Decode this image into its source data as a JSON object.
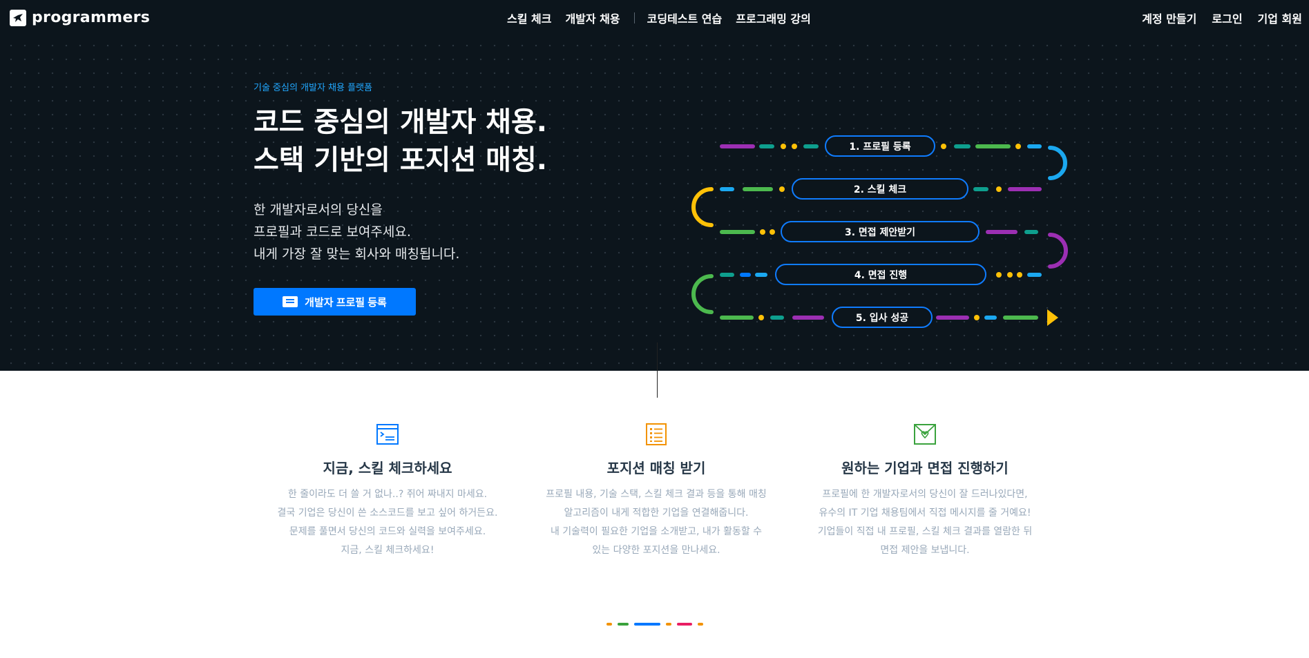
{
  "header": {
    "logo_text": "programmers",
    "nav": [
      "스킬 체크",
      "개발자 채용",
      "코딩테스트 연습",
      "프로그래밍 강의"
    ],
    "auth": [
      "계정 만들기",
      "로그인",
      "기업 회원"
    ]
  },
  "hero": {
    "eyebrow": "기술 중심의 개발자 채용 플랫폼",
    "title_line1": "코드 중심의 개발자 채용.",
    "title_line2": "스택 기반의 포지션 매칭.",
    "sub_line1": "한 개발자로서의 당신을",
    "sub_line2": "프로필과 코드로 보여주세요.",
    "sub_line3": "내게 가장 잘 맞는 회사와 매칭됩니다.",
    "cta_label": "개발자 프로필 등록"
  },
  "flow": {
    "steps": [
      "1. 프로필 등록",
      "2. 스킬 체크",
      "3. 면접 제안받기",
      "4. 면접 진행",
      "5. 입사 성공"
    ],
    "colors": {
      "blue": "#0078ff",
      "cyan": "#1ba8f0",
      "green": "#4cb94e",
      "teal": "#0e9f8e",
      "purple": "#9c2fb3",
      "yellow": "#ffc107"
    }
  },
  "features": [
    {
      "icon": "code-window-icon",
      "title": "지금, 스킬 체크하세요",
      "desc": [
        "한 줄이라도 더 쓸 거 없나..? 쥐어 짜내지 마세요.",
        "결국 기업은 당신이 쓴 소스코드를 보고 싶어 하거든요.",
        "문제를 풀면서 당신의 코드와 실력을 보여주세요.",
        "지금, 스킬 체크하세요!"
      ]
    },
    {
      "icon": "checklist-icon",
      "title": "포지션 매칭 받기",
      "desc": [
        "프로필 내용, 기술 스택, 스킬 체크 결과 등을 통해 매칭",
        "알고리즘이 내게 적합한 기업을 연결해줍니다.",
        "내 기술력이 필요한 기업을 소개받고, 내가 활동할 수",
        "있는 다양한 포지션을 만나세요."
      ]
    },
    {
      "icon": "heart-envelope-icon",
      "title": "원하는 기업과 면접 진행하기",
      "desc": [
        "프로필에 한 개발자로서의 당신이 잘 드러나있다면,",
        "유수의 IT 기업 채용팀에서 직접 메시지를 줄 거예요!",
        "기업들이 직접 내 프로필, 스킬 체크 결과를 열람한 뒤",
        "면접 제안을 보냅니다."
      ]
    }
  ]
}
